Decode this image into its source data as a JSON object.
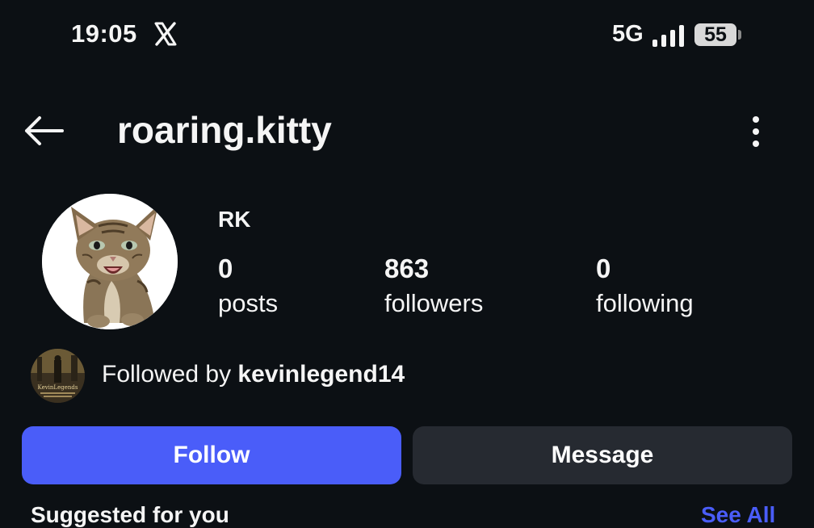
{
  "status_bar": {
    "time": "19:05",
    "app_icon": "x-logo-icon",
    "network": "5G",
    "battery": "55"
  },
  "header": {
    "username": "roaring.kitty",
    "back_icon": "back-arrow-icon",
    "more_icon": "more-vertical-icon"
  },
  "profile": {
    "display_name": "RK",
    "stats": {
      "posts": {
        "value": "0",
        "label": "posts"
      },
      "followers": {
        "value": "863",
        "label": "followers"
      },
      "following": {
        "value": "0",
        "label": "following"
      }
    },
    "followed_by": {
      "prefix": "Followed by ",
      "user": "kevinlegend14",
      "avatar_text": "KevinLegends"
    }
  },
  "actions": {
    "follow_label": "Follow",
    "message_label": "Message"
  },
  "colors": {
    "background": "#0c1014",
    "follow_button": "#4a5df9",
    "message_button": "#262a31",
    "link": "#4a5df9"
  },
  "below_fold": {
    "section_title": "Suggested for you",
    "see_all": "See All"
  }
}
